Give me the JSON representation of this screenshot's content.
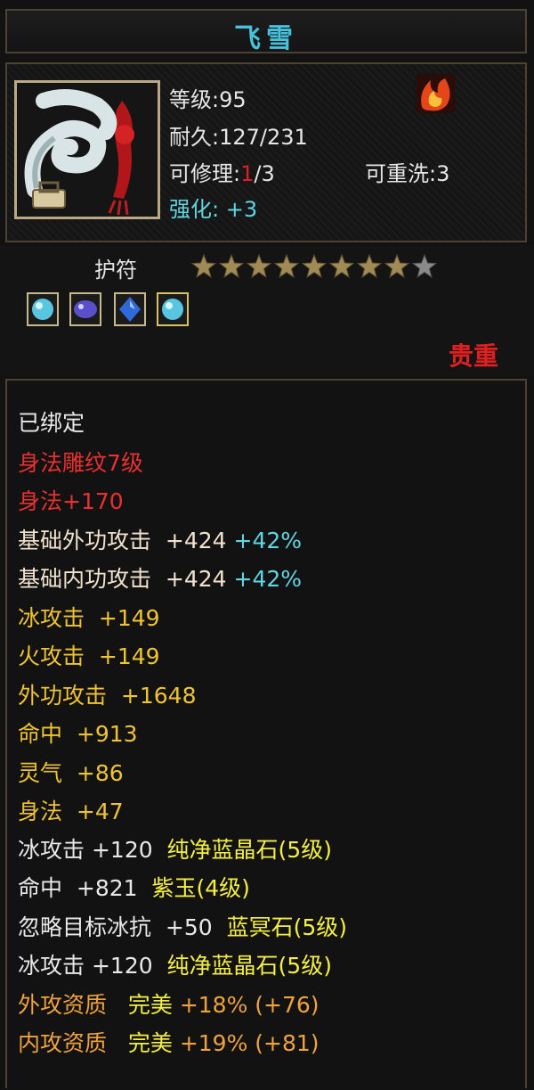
{
  "item": {
    "name": "飞雪",
    "level_label": "等级:",
    "level": "95",
    "durability_label": "耐久:",
    "durability": "127/231",
    "repair_label": "可修理:",
    "repair_used": "1",
    "repair_total": "/3",
    "rewash_label": "可重洗:",
    "rewash": "3",
    "enhance_label": "强化:",
    "enhance": "+3",
    "element_icon": "fire-element-icon"
  },
  "amulet": {
    "label": "护符",
    "stars_filled": 8,
    "stars_total": 9,
    "gems": [
      "cyan-gem-icon",
      "purple-gem-icon",
      "blue-gem-icon",
      "cyan-gem-icon"
    ],
    "rarity": "贵重"
  },
  "attributes": {
    "bound": "已绑定",
    "engrave": "身法雕纹7级",
    "engrave_bonus": "身法+170",
    "base_ext_atk": {
      "name": "基础外功攻击",
      "value": "+424",
      "pct": "+42%"
    },
    "base_int_atk": {
      "name": "基础内功攻击",
      "value": "+424",
      "pct": "+42%"
    },
    "ice_atk": {
      "name": "冰攻击",
      "value": "+149"
    },
    "fire_atk": {
      "name": "火攻击",
      "value": "+149"
    },
    "ext_atk": {
      "name": "外功攻击",
      "value": "+1648"
    },
    "hit": {
      "name": "命中",
      "value": "+913"
    },
    "spirit": {
      "name": "灵气",
      "value": "+86"
    },
    "agility": {
      "name": "身法",
      "value": "+47"
    },
    "gem1": {
      "name": "冰攻击",
      "value": "+120",
      "gem": "纯净蓝晶石(5级)"
    },
    "gem2": {
      "name": "命中",
      "value": "+821",
      "gem": "紫玉(4级)"
    },
    "gem3": {
      "name": "忽略目标冰抗",
      "value": "+50",
      "gem": "蓝冥石(5级)"
    },
    "gem4": {
      "name": "冰攻击",
      "value": "+120",
      "gem": "纯净蓝晶石(5级)"
    },
    "apt1": {
      "name": "外攻资质",
      "grade": "完美",
      "pct": "+18%",
      "bonus": "(+76)"
    },
    "apt2": {
      "name": "内攻资质",
      "grade": "完美",
      "pct": "+19%",
      "bonus": "(+81)"
    }
  },
  "colors": {
    "title": "#46c2dc",
    "bound": "#e8e8e8",
    "engrave": "#e83030",
    "base_attack": "#f1e2cf",
    "percent": "#5fd6e4",
    "stat": "#f0c330",
    "gem_name": "#f5f040",
    "aptitude": "#f0a23c",
    "rarity": "#e02020"
  }
}
